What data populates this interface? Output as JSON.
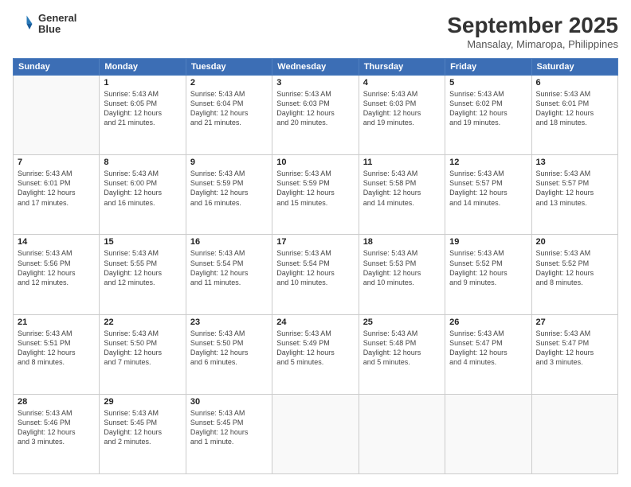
{
  "header": {
    "logo_line1": "General",
    "logo_line2": "Blue",
    "month": "September 2025",
    "location": "Mansalay, Mimaropa, Philippines"
  },
  "days_of_week": [
    "Sunday",
    "Monday",
    "Tuesday",
    "Wednesday",
    "Thursday",
    "Friday",
    "Saturday"
  ],
  "weeks": [
    [
      {
        "day": "",
        "info": ""
      },
      {
        "day": "1",
        "info": "Sunrise: 5:43 AM\nSunset: 6:05 PM\nDaylight: 12 hours\nand 21 minutes."
      },
      {
        "day": "2",
        "info": "Sunrise: 5:43 AM\nSunset: 6:04 PM\nDaylight: 12 hours\nand 21 minutes."
      },
      {
        "day": "3",
        "info": "Sunrise: 5:43 AM\nSunset: 6:03 PM\nDaylight: 12 hours\nand 20 minutes."
      },
      {
        "day": "4",
        "info": "Sunrise: 5:43 AM\nSunset: 6:03 PM\nDaylight: 12 hours\nand 19 minutes."
      },
      {
        "day": "5",
        "info": "Sunrise: 5:43 AM\nSunset: 6:02 PM\nDaylight: 12 hours\nand 19 minutes."
      },
      {
        "day": "6",
        "info": "Sunrise: 5:43 AM\nSunset: 6:01 PM\nDaylight: 12 hours\nand 18 minutes."
      }
    ],
    [
      {
        "day": "7",
        "info": "Sunrise: 5:43 AM\nSunset: 6:01 PM\nDaylight: 12 hours\nand 17 minutes."
      },
      {
        "day": "8",
        "info": "Sunrise: 5:43 AM\nSunset: 6:00 PM\nDaylight: 12 hours\nand 16 minutes."
      },
      {
        "day": "9",
        "info": "Sunrise: 5:43 AM\nSunset: 5:59 PM\nDaylight: 12 hours\nand 16 minutes."
      },
      {
        "day": "10",
        "info": "Sunrise: 5:43 AM\nSunset: 5:59 PM\nDaylight: 12 hours\nand 15 minutes."
      },
      {
        "day": "11",
        "info": "Sunrise: 5:43 AM\nSunset: 5:58 PM\nDaylight: 12 hours\nand 14 minutes."
      },
      {
        "day": "12",
        "info": "Sunrise: 5:43 AM\nSunset: 5:57 PM\nDaylight: 12 hours\nand 14 minutes."
      },
      {
        "day": "13",
        "info": "Sunrise: 5:43 AM\nSunset: 5:57 PM\nDaylight: 12 hours\nand 13 minutes."
      }
    ],
    [
      {
        "day": "14",
        "info": "Sunrise: 5:43 AM\nSunset: 5:56 PM\nDaylight: 12 hours\nand 12 minutes."
      },
      {
        "day": "15",
        "info": "Sunrise: 5:43 AM\nSunset: 5:55 PM\nDaylight: 12 hours\nand 12 minutes."
      },
      {
        "day": "16",
        "info": "Sunrise: 5:43 AM\nSunset: 5:54 PM\nDaylight: 12 hours\nand 11 minutes."
      },
      {
        "day": "17",
        "info": "Sunrise: 5:43 AM\nSunset: 5:54 PM\nDaylight: 12 hours\nand 10 minutes."
      },
      {
        "day": "18",
        "info": "Sunrise: 5:43 AM\nSunset: 5:53 PM\nDaylight: 12 hours\nand 10 minutes."
      },
      {
        "day": "19",
        "info": "Sunrise: 5:43 AM\nSunset: 5:52 PM\nDaylight: 12 hours\nand 9 minutes."
      },
      {
        "day": "20",
        "info": "Sunrise: 5:43 AM\nSunset: 5:52 PM\nDaylight: 12 hours\nand 8 minutes."
      }
    ],
    [
      {
        "day": "21",
        "info": "Sunrise: 5:43 AM\nSunset: 5:51 PM\nDaylight: 12 hours\nand 8 minutes."
      },
      {
        "day": "22",
        "info": "Sunrise: 5:43 AM\nSunset: 5:50 PM\nDaylight: 12 hours\nand 7 minutes."
      },
      {
        "day": "23",
        "info": "Sunrise: 5:43 AM\nSunset: 5:50 PM\nDaylight: 12 hours\nand 6 minutes."
      },
      {
        "day": "24",
        "info": "Sunrise: 5:43 AM\nSunset: 5:49 PM\nDaylight: 12 hours\nand 5 minutes."
      },
      {
        "day": "25",
        "info": "Sunrise: 5:43 AM\nSunset: 5:48 PM\nDaylight: 12 hours\nand 5 minutes."
      },
      {
        "day": "26",
        "info": "Sunrise: 5:43 AM\nSunset: 5:47 PM\nDaylight: 12 hours\nand 4 minutes."
      },
      {
        "day": "27",
        "info": "Sunrise: 5:43 AM\nSunset: 5:47 PM\nDaylight: 12 hours\nand 3 minutes."
      }
    ],
    [
      {
        "day": "28",
        "info": "Sunrise: 5:43 AM\nSunset: 5:46 PM\nDaylight: 12 hours\nand 3 minutes."
      },
      {
        "day": "29",
        "info": "Sunrise: 5:43 AM\nSunset: 5:45 PM\nDaylight: 12 hours\nand 2 minutes."
      },
      {
        "day": "30",
        "info": "Sunrise: 5:43 AM\nSunset: 5:45 PM\nDaylight: 12 hours\nand 1 minute."
      },
      {
        "day": "",
        "info": ""
      },
      {
        "day": "",
        "info": ""
      },
      {
        "day": "",
        "info": ""
      },
      {
        "day": "",
        "info": ""
      }
    ]
  ]
}
